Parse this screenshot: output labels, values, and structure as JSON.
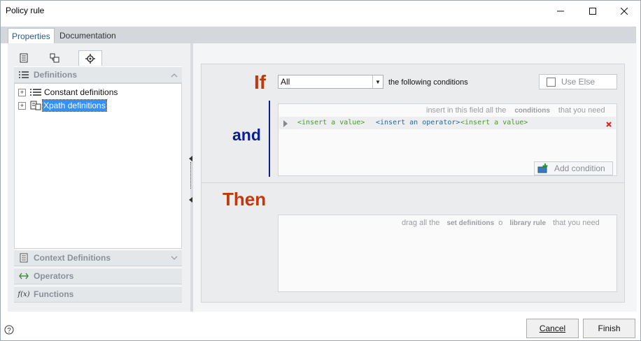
{
  "window": {
    "title": "Policy rule"
  },
  "tabs": [
    {
      "label": "Properties"
    },
    {
      "label": "Documentation"
    }
  ],
  "icon_tabs": [
    {
      "icon": "document-icon"
    },
    {
      "icon": "structure-icon"
    },
    {
      "icon": "gear-icon"
    }
  ],
  "left_panel": {
    "sections": {
      "definitions": "Definitions",
      "context": "Context Definitions",
      "operators": "Operators",
      "functions": "Functions",
      "functions_icon_text": "f(x)"
    },
    "tree": [
      {
        "label": "Constant definitions"
      },
      {
        "label": "Xpath definitions"
      }
    ]
  },
  "rule": {
    "if_label": "If",
    "and_label": "and",
    "then_label": "Then",
    "match_select": "All",
    "following_text": "the following conditions",
    "use_else": "Use Else",
    "conditions_hint": {
      "pre": "insert in this field all the",
      "bold": "conditions",
      "post": "that you need"
    },
    "condition_row": {
      "left": "<insert a value>",
      "operator": "<insert an operator>",
      "right": "<insert a value>"
    },
    "add_condition": "Add condition",
    "then_hint": {
      "pre": "drag all the",
      "bold1": "set definitions",
      "mid": "o",
      "bold2": "library rule",
      "post": "that you need"
    }
  },
  "footer": {
    "cancel": "Cancel",
    "finish": "Finish"
  },
  "colors": {
    "if": "#c0390b",
    "and": "#0d1f8a",
    "then": "#c0390b",
    "selection": "#3390ff"
  }
}
